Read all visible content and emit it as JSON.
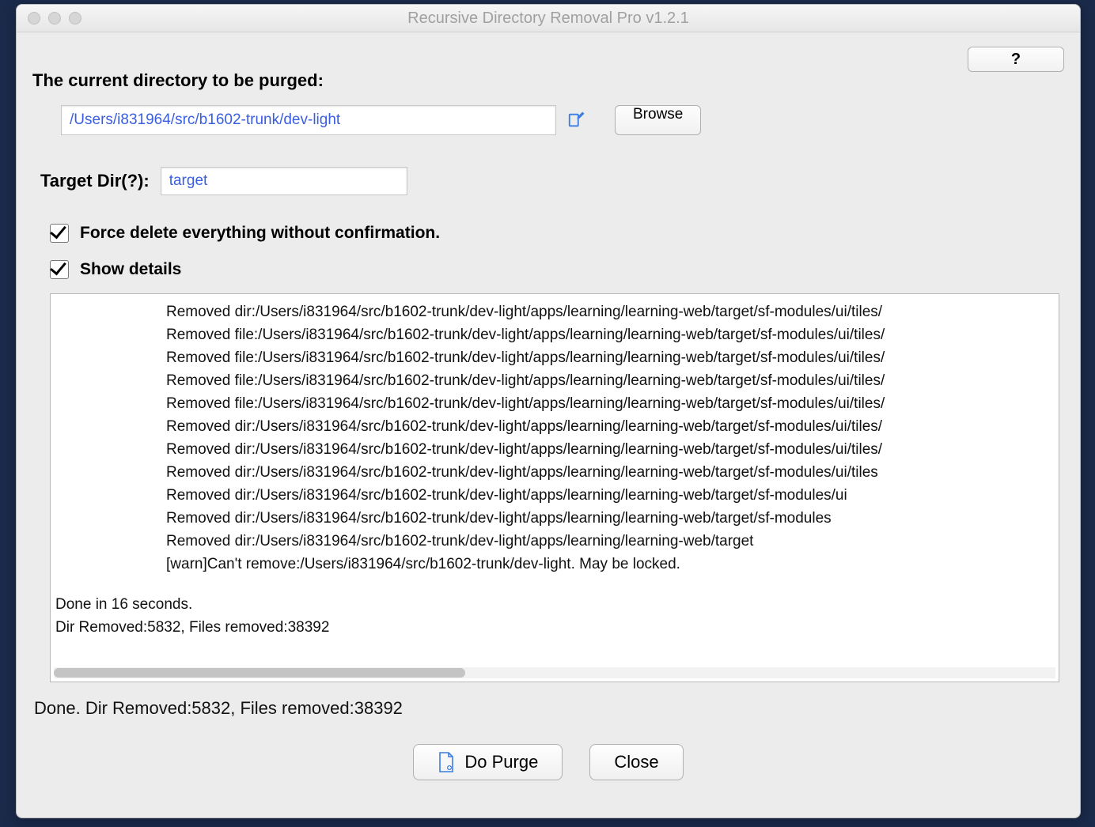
{
  "window": {
    "title": "Recursive Directory Removal Pro v1.2.1"
  },
  "help_button_label": "?",
  "main_label": "The current directory to be purged:",
  "path_input_value": "/Users/i831964/src/b1602-trunk/dev-light",
  "browse_label": "Browse",
  "target_dir_label": "Target Dir(?):",
  "target_dir_value": "target",
  "force_delete_label": "Force delete everything without confirmation.",
  "force_delete_checked": true,
  "show_details_label": "Show details",
  "show_details_checked": true,
  "log_lines": [
    "Removed dir:/Users/i831964/src/b1602-trunk/dev-light/apps/learning/learning-web/target/sf-modules/ui/tiles/",
    "Removed file:/Users/i831964/src/b1602-trunk/dev-light/apps/learning/learning-web/target/sf-modules/ui/tiles/",
    "Removed file:/Users/i831964/src/b1602-trunk/dev-light/apps/learning/learning-web/target/sf-modules/ui/tiles/",
    "Removed file:/Users/i831964/src/b1602-trunk/dev-light/apps/learning/learning-web/target/sf-modules/ui/tiles/",
    "Removed file:/Users/i831964/src/b1602-trunk/dev-light/apps/learning/learning-web/target/sf-modules/ui/tiles/",
    "Removed dir:/Users/i831964/src/b1602-trunk/dev-light/apps/learning/learning-web/target/sf-modules/ui/tiles/",
    "Removed dir:/Users/i831964/src/b1602-trunk/dev-light/apps/learning/learning-web/target/sf-modules/ui/tiles/",
    "Removed dir:/Users/i831964/src/b1602-trunk/dev-light/apps/learning/learning-web/target/sf-modules/ui/tiles",
    "Removed dir:/Users/i831964/src/b1602-trunk/dev-light/apps/learning/learning-web/target/sf-modules/ui",
    "Removed dir:/Users/i831964/src/b1602-trunk/dev-light/apps/learning/learning-web/target/sf-modules",
    "Removed dir:/Users/i831964/src/b1602-trunk/dev-light/apps/learning/learning-web/target",
    "[warn]Can't remove:/Users/i831964/src/b1602-trunk/dev-light. May be locked."
  ],
  "log_summary": "Done in 16 seconds.\nDir Removed:5832, Files removed:38392",
  "status_line": "Done. Dir Removed:5832, Files removed:38392",
  "do_purge_label": "Do Purge",
  "close_label": "Close"
}
